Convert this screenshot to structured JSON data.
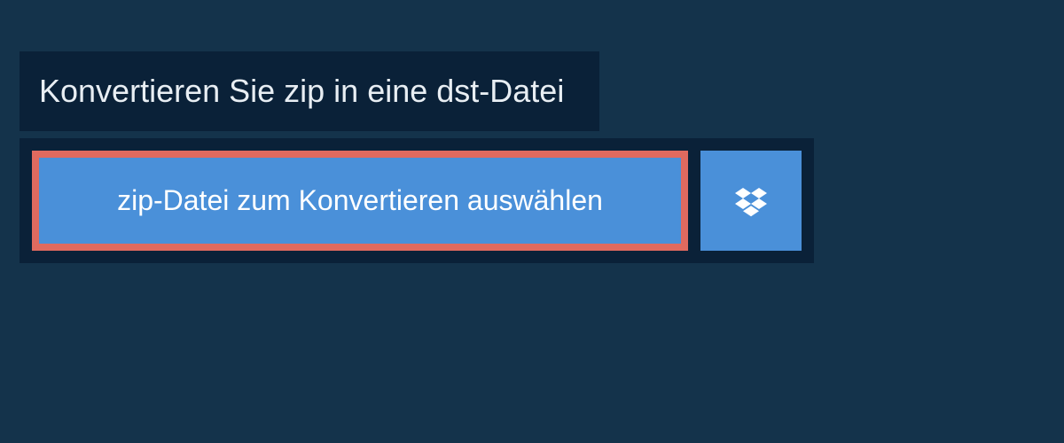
{
  "header": {
    "title": "Konvertieren Sie zip in eine dst-Datei"
  },
  "upload": {
    "select_label": "zip-Datei zum Konvertieren auswählen"
  },
  "colors": {
    "page_bg": "#14334b",
    "panel_bg": "#0a2138",
    "button_bg": "#4a90d9",
    "highlight_border": "#e06a5f"
  }
}
